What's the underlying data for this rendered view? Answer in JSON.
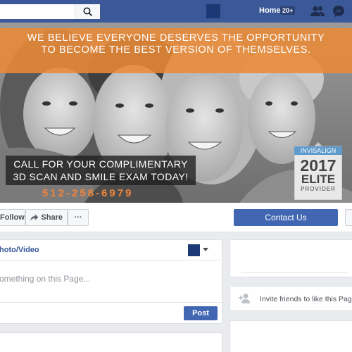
{
  "topbar": {
    "nav_home": "Home",
    "notification_count": "20+",
    "icons": [
      "search-icon",
      "friends-icon",
      "messenger-icon"
    ]
  },
  "cover": {
    "banner_line1": "WE BELIEVE EVERYONE DESERVES THE OPPORTUNITY",
    "banner_line2": "TO BECOME THE BEST VERSION OF THEMSELVES.",
    "cta_line1": "CALL FOR YOUR COMPLIMENTARY",
    "cta_line2": "3D SCAN AND SMILE EXAM TODAY!",
    "phone": "512-258-6979",
    "badge": {
      "brand": "INVISALIGN",
      "year": "2017",
      "tier": "ELITE",
      "label": "PROVIDER"
    }
  },
  "actions": {
    "follow": "Follow",
    "share": "Share",
    "more": "···",
    "contact": "Contact Us"
  },
  "composer": {
    "tab_label": "hoto/Video",
    "placeholder": "omething on this Page...",
    "post": "Post"
  },
  "sidebar": {
    "invite_text": "Invite friends to like this Page"
  },
  "colors": {
    "facebook_blue": "#3b5998",
    "button_blue": "#4267b2",
    "banner_orange": "#ec8934",
    "phone_orange": "#f0863a",
    "invisalign_blue": "#5e9bcc"
  }
}
